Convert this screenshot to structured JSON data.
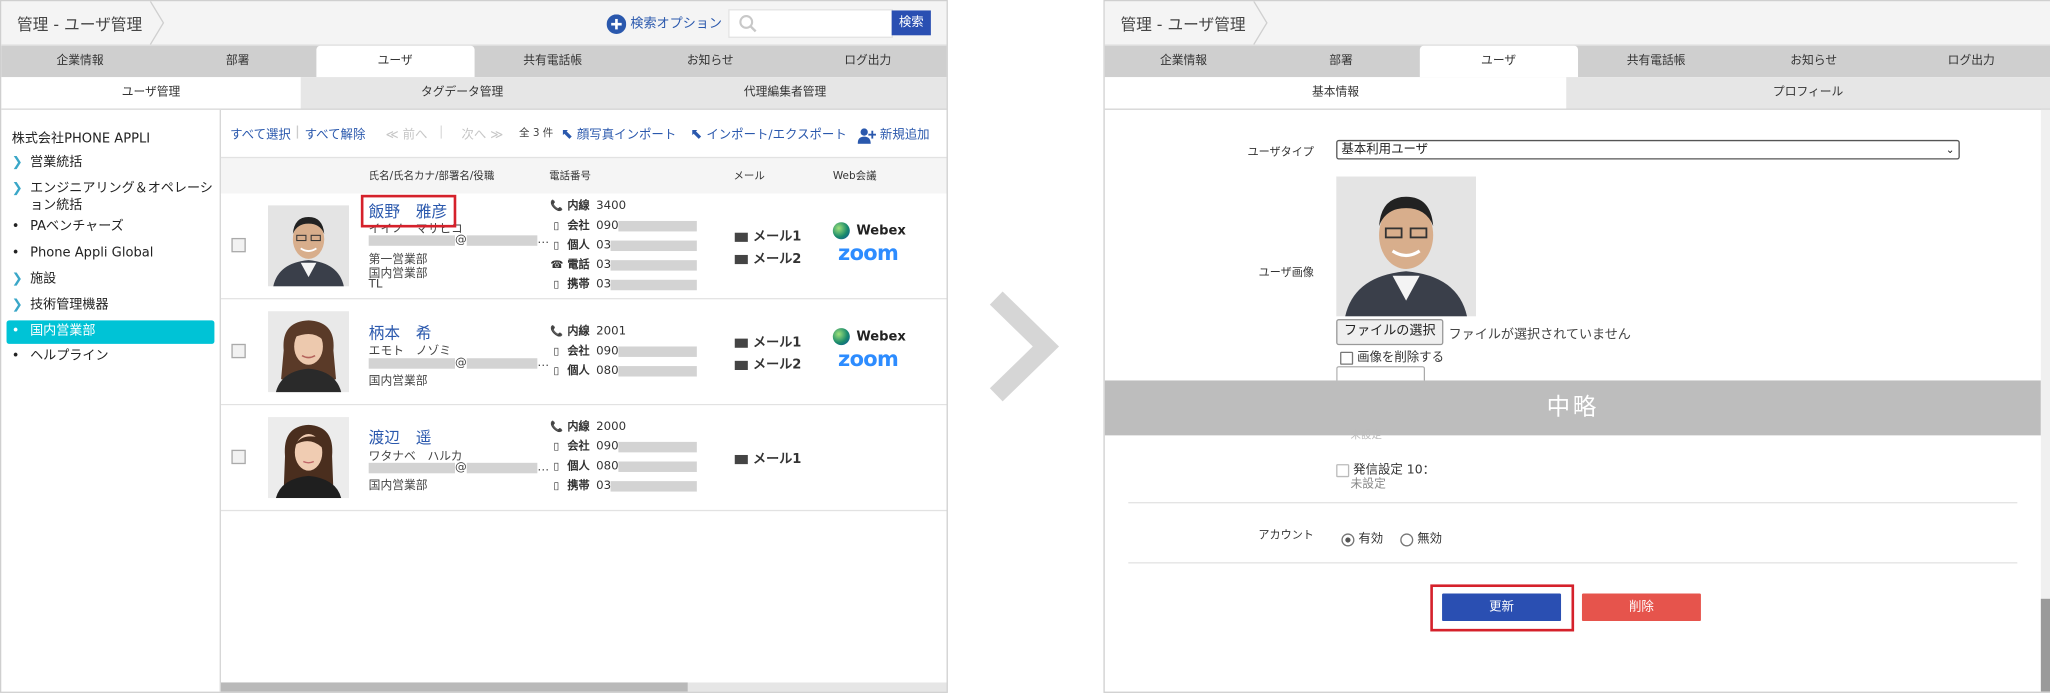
{
  "left": {
    "breadcrumb": "管理 - ユーザ管理",
    "search_option": "検索オプション",
    "search_button": "検索",
    "search_placeholder": "",
    "tabs": [
      "企業情報",
      "部署",
      "ユーザ",
      "共有電話帳",
      "お知らせ",
      "ログ出力"
    ],
    "subtabs": [
      "ユーザ管理",
      "タグデータ管理",
      "代理編集者管理"
    ],
    "company": "株式会社PHONE APPLI",
    "sidebar": [
      "営業統括",
      "エンジニアリング＆オペレーション統括",
      "PAベンチャーズ",
      "Phone Appli Global",
      "施設",
      "技術管理機器",
      "国内営業部",
      "ヘルプライン"
    ],
    "toolbar": {
      "select_all": "すべて選択",
      "deselect_all": "すべて解除",
      "prev": "≪ 前へ",
      "next": "次へ ≫",
      "count": "全 3 件",
      "photo_import": "顔写真インポート",
      "import_export": "インポート/エクスポート",
      "add_new": "新規追加"
    },
    "columns": {
      "name": "氏名/氏名カナ/部署名/役職",
      "phone": "電話番号",
      "mail": "メール",
      "web": "Web会議"
    },
    "rows": [
      {
        "name": "飯野　雅彦",
        "kana": "イイノ　マサヒコ",
        "email_mark": "@",
        "depts": [
          "第一営業部",
          "国内営業部",
          "TL"
        ],
        "phones": [
          {
            "label": "内線",
            "value": "3400"
          },
          {
            "label": "会社",
            "value": "090"
          },
          {
            "label": "個人",
            "value": "03"
          },
          {
            "label": "電話",
            "value": "03"
          },
          {
            "label": "携帯",
            "value": "03"
          }
        ],
        "mails": [
          "メール1",
          "メール2"
        ],
        "webex": "Webex",
        "zoom": "zoom"
      },
      {
        "name": "柄本　希",
        "kana": "エモト　ノゾミ",
        "email_mark": "@",
        "depts": [
          "国内営業部"
        ],
        "phones": [
          {
            "label": "内線",
            "value": "2001"
          },
          {
            "label": "会社",
            "value": "090"
          },
          {
            "label": "個人",
            "value": "080"
          }
        ],
        "mails": [
          "メール1",
          "メール2"
        ],
        "webex": "Webex",
        "zoom": "zoom"
      },
      {
        "name": "渡辺　遥",
        "kana": "ワタナベ　ハルカ",
        "email_mark": "@",
        "depts": [
          "国内営業部"
        ],
        "phones": [
          {
            "label": "内線",
            "value": "2000"
          },
          {
            "label": "会社",
            "value": "090"
          },
          {
            "label": "個人",
            "value": "080"
          },
          {
            "label": "携帯",
            "value": "03"
          }
        ],
        "mails": [
          "メール1"
        ]
      }
    ]
  },
  "right": {
    "breadcrumb": "管理 - ユーザ管理",
    "tabs": [
      "企業情報",
      "部署",
      "ユーザ",
      "共有電話帳",
      "お知らせ",
      "ログ出力"
    ],
    "subtabs": [
      "基本情報",
      "プロフィール"
    ],
    "user_type_label": "ユーザタイプ",
    "user_type_value": "基本利用ユーザ",
    "user_image_label": "ユーザ画像",
    "file_button": "ファイルの選択",
    "no_file": "ファイルが選択されていません",
    "delete_image": "画像を削除する",
    "omitted": "中略",
    "faded_text": "未設定",
    "send_setting_label": "発信設定 10：",
    "send_setting_value": "未設定",
    "account_label": "アカウント",
    "account_enabled": "有効",
    "account_disabled": "無効",
    "update_button": "更新",
    "delete_button": "削除"
  },
  "colors": {
    "accent_blue": "#2a58ad",
    "sidebar_active": "#00c3d6",
    "highlight_red": "#d5212b",
    "update_blue": "#2a4fb2",
    "delete_red": "#e6544c",
    "arrow_gray": "#d6d6d6"
  }
}
